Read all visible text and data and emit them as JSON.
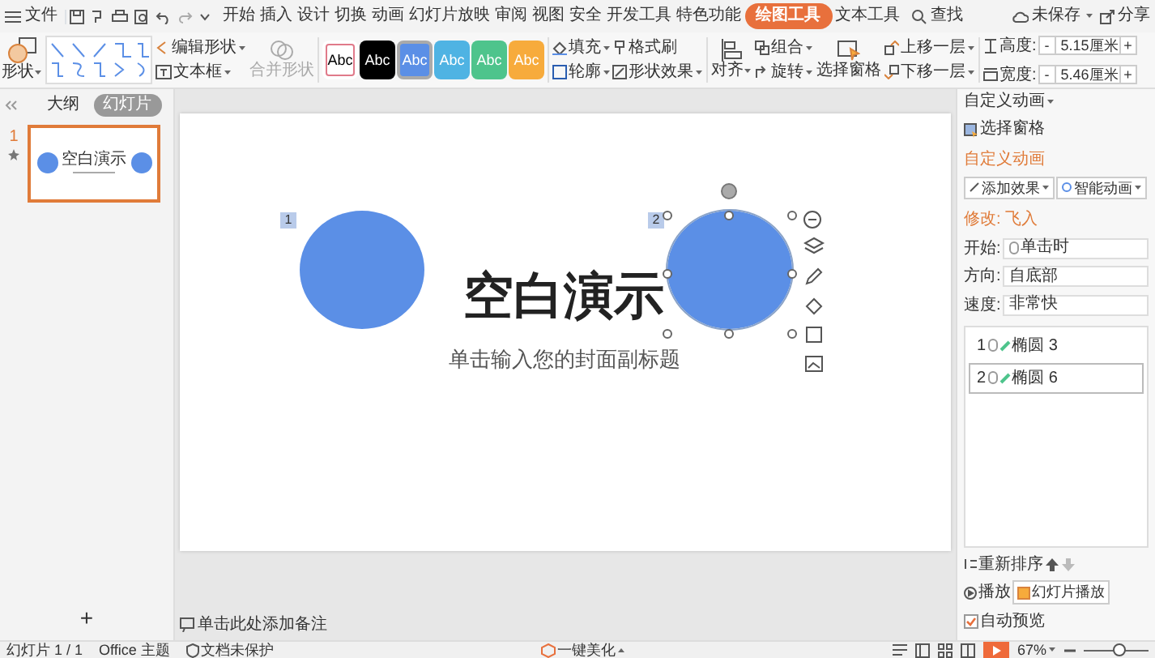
{
  "menu": {
    "file": "文件",
    "tabs": [
      {
        "label": "开始",
        "selected": false
      },
      {
        "label": "插入",
        "selected": false
      },
      {
        "label": "设计",
        "selected": false
      },
      {
        "label": "切换",
        "selected": false
      },
      {
        "label": "动画",
        "selected": false
      },
      {
        "label": "幻灯片放映",
        "selected": false
      },
      {
        "label": "审阅",
        "selected": false
      },
      {
        "label": "视图",
        "selected": false
      },
      {
        "label": "安全",
        "selected": false
      },
      {
        "label": "开发工具",
        "selected": false
      },
      {
        "label": "特色功能",
        "selected": false
      },
      {
        "label": "绘图工具",
        "selected": true
      },
      {
        "label": "文本工具",
        "selected": false
      }
    ],
    "search": "查找",
    "save_status": "未保存",
    "share": "分享"
  },
  "ribbon": {
    "shape": "形状",
    "edit_shape": "编辑形状",
    "text_box": "文本框",
    "merge_shape": {
      "label": "合并形状",
      "disabled": true
    },
    "swatches": [
      {
        "label": "Abc",
        "color": "#ffffff",
        "selected": false
      },
      {
        "label": "Abc",
        "color": "#000000",
        "selected": false
      },
      {
        "label": "Abc",
        "color": "#5b8fe6",
        "selected": true
      },
      {
        "label": "Abc",
        "color": "#4fb3e3",
        "selected": false
      },
      {
        "label": "Abc",
        "color": "#4ec48c",
        "selected": false
      },
      {
        "label": "Abc",
        "color": "#f7ab3c",
        "selected": false
      }
    ],
    "fill": "填充",
    "format_painter": "格式刷",
    "outline": "轮廓",
    "shape_effects": "形状效果",
    "align": "对齐",
    "group": "组合",
    "rotate": "旋转",
    "selection_pane": "选择窗格",
    "bring_forward": "上移一层",
    "send_backward": "下移一层",
    "height": {
      "label": "高度:",
      "value": "5.15厘米",
      "decrement": "-",
      "increment": "+"
    },
    "width": {
      "label": "宽度:",
      "value": "5.46厘米",
      "decrement": "-",
      "increment": "+"
    }
  },
  "left_panel": {
    "tabs": [
      {
        "label": "大纲",
        "selected": false
      },
      {
        "label": "幻灯片",
        "selected": true
      }
    ],
    "slides": [
      {
        "number": "1",
        "title": "空白演示",
        "selected": true
      }
    ],
    "add": "+"
  },
  "slide": {
    "title": "空白演示",
    "subtitle": "单击输入您的封面副标题",
    "shapes": [
      {
        "tag": "1",
        "selected": false
      },
      {
        "tag": "2",
        "selected": true
      }
    ]
  },
  "notes": "单击此处添加备注",
  "right_panel": {
    "header": "自定义动画",
    "selection_pane": "选择窗格",
    "section_title": "自定义动画",
    "add_effect": "添加效果",
    "smart_animation": "智能动画",
    "modify": "修改: 飞入",
    "fields": [
      {
        "label": "开始:",
        "value": "单击时"
      },
      {
        "label": "方向:",
        "value": "自底部"
      },
      {
        "label": "速度:",
        "value": "非常快"
      }
    ],
    "animations": [
      {
        "number": "1",
        "name": "椭圆 3",
        "selected": false
      },
      {
        "number": "2",
        "name": "椭圆 6",
        "selected": true
      }
    ],
    "reorder": "重新排序",
    "play": "播放",
    "slideshow": "幻灯片播放",
    "auto_preview": {
      "label": "自动预览",
      "checked": true
    }
  },
  "status_bar": {
    "slide": "幻灯片 1 / 1",
    "theme": "Office 主题",
    "protection": "文档未保护",
    "beautify": "一键美化",
    "zoom": "67%",
    "zoom_slider": {
      "level": 0.55
    }
  }
}
